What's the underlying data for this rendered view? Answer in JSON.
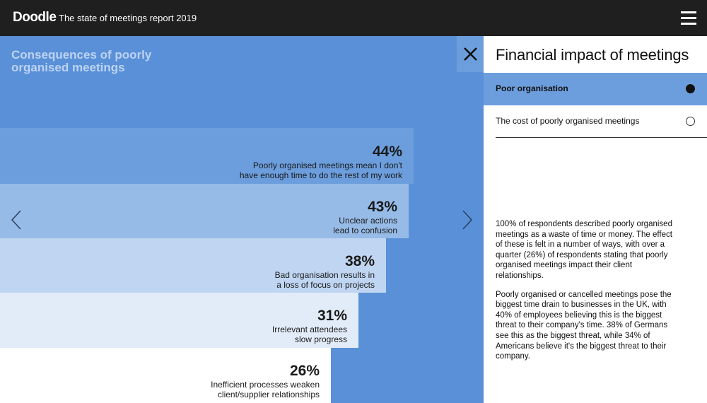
{
  "header": {
    "logo": "Doodle",
    "title": "The state of meetings report 2019"
  },
  "visual": {
    "title": "Consequences of poorly organised meetings",
    "steps": [
      {
        "percent": "44%",
        "line1": "Poorly organised meetings mean I don't",
        "line2": "have enough time to do the rest of my work"
      },
      {
        "percent": "43%",
        "line1": "Unclear actions",
        "line2": "lead to confusion"
      },
      {
        "percent": "38%",
        "line1": "Bad organisation results in",
        "line2": "a loss of focus on projects"
      },
      {
        "percent": "31%",
        "line1": "Irrelevant attendees",
        "line2": "slow progress"
      },
      {
        "percent": "26%",
        "line1": "Inefficient processes weaken",
        "line2": "client/supplier relationships"
      }
    ],
    "levels": [
      0.44,
      0.43,
      0.38,
      0.31,
      0.26
    ]
  },
  "panel": {
    "title": "Financial impact of meetings",
    "options": [
      {
        "label": "Poor organisation",
        "selected": true
      },
      {
        "label": "The cost of poorly organised meetings",
        "selected": false
      }
    ],
    "paragraphs": [
      "100% of respondents described poorly organised meetings as a waste of time or money. The effect of these is felt in a number of ways, with over a quarter (26%) of respondents stating that poorly organised meetings impact their client relationships.",
      "Poorly organised or cancelled meetings pose the biggest time drain to businesses in the UK, with 40% of employees believing this is the biggest threat to their company's time. 38% of Germans see this as the biggest threat, while 34% of Americans believe it's the biggest threat to their company."
    ]
  },
  "icons": {
    "menu": "hamburger-menu-icon",
    "close": "close-icon",
    "prev": "chevron-left-icon",
    "next": "chevron-right-icon",
    "radio_selected": "radio-selected-icon",
    "radio_empty": "radio-empty-icon"
  },
  "colors": {
    "topbar": "#1f1f1f",
    "accent_blue": "#5a90d8",
    "selected_option": "#6c9edd"
  }
}
